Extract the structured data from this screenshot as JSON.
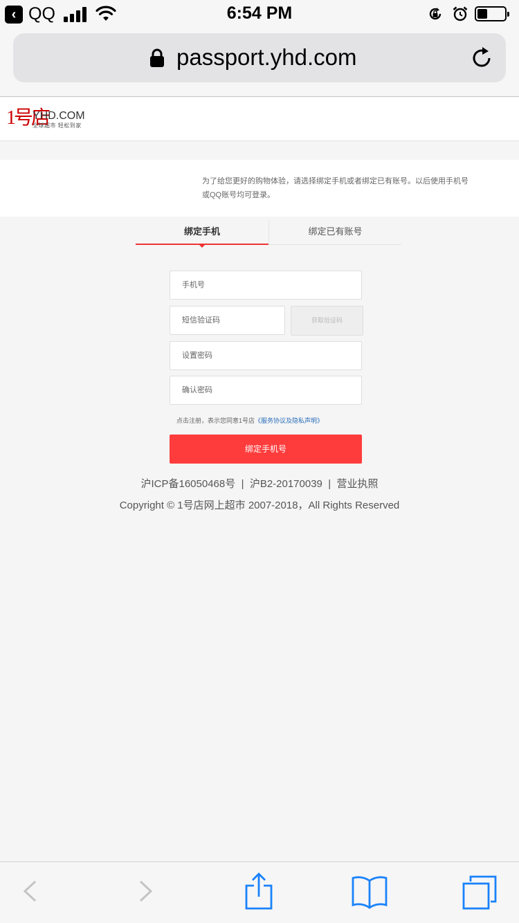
{
  "status_bar": {
    "back_app": "QQ",
    "time": "6:54 PM"
  },
  "address_bar": {
    "url": "passport.yhd.com"
  },
  "logo": {
    "mark": "1号店",
    "text": "YHD.COM",
    "sub": "全球超市 轻松到家"
  },
  "notice": {
    "text": "为了给您更好的购物体验，请选择绑定手机或者绑定已有账号。以后使用手机号或QQ账号均可登录。"
  },
  "tabs": [
    {
      "label": "绑定手机",
      "active": true
    },
    {
      "label": "绑定已有账号",
      "active": false
    }
  ],
  "form": {
    "phone_placeholder": "手机号",
    "sms_placeholder": "短信验证码",
    "sms_button": "获取验证码",
    "password_placeholder": "设置密码",
    "confirm_placeholder": "确认密码",
    "terms_prefix": "点击注册，表示您同意1号店",
    "terms_link": "《服务协议及隐私声明》",
    "submit_label": "绑定手机号"
  },
  "footer": {
    "icp": "沪ICP备16050468号",
    "b2": "沪B2-20170039",
    "license": "营业执照",
    "copyright": "Copyright © 1号店网上超市 2007-2018，All Rights Reserved"
  },
  "colors": {
    "accent": "#ff3c3c",
    "link": "#2a6ebb",
    "ios_blue": "#1a82fb"
  }
}
